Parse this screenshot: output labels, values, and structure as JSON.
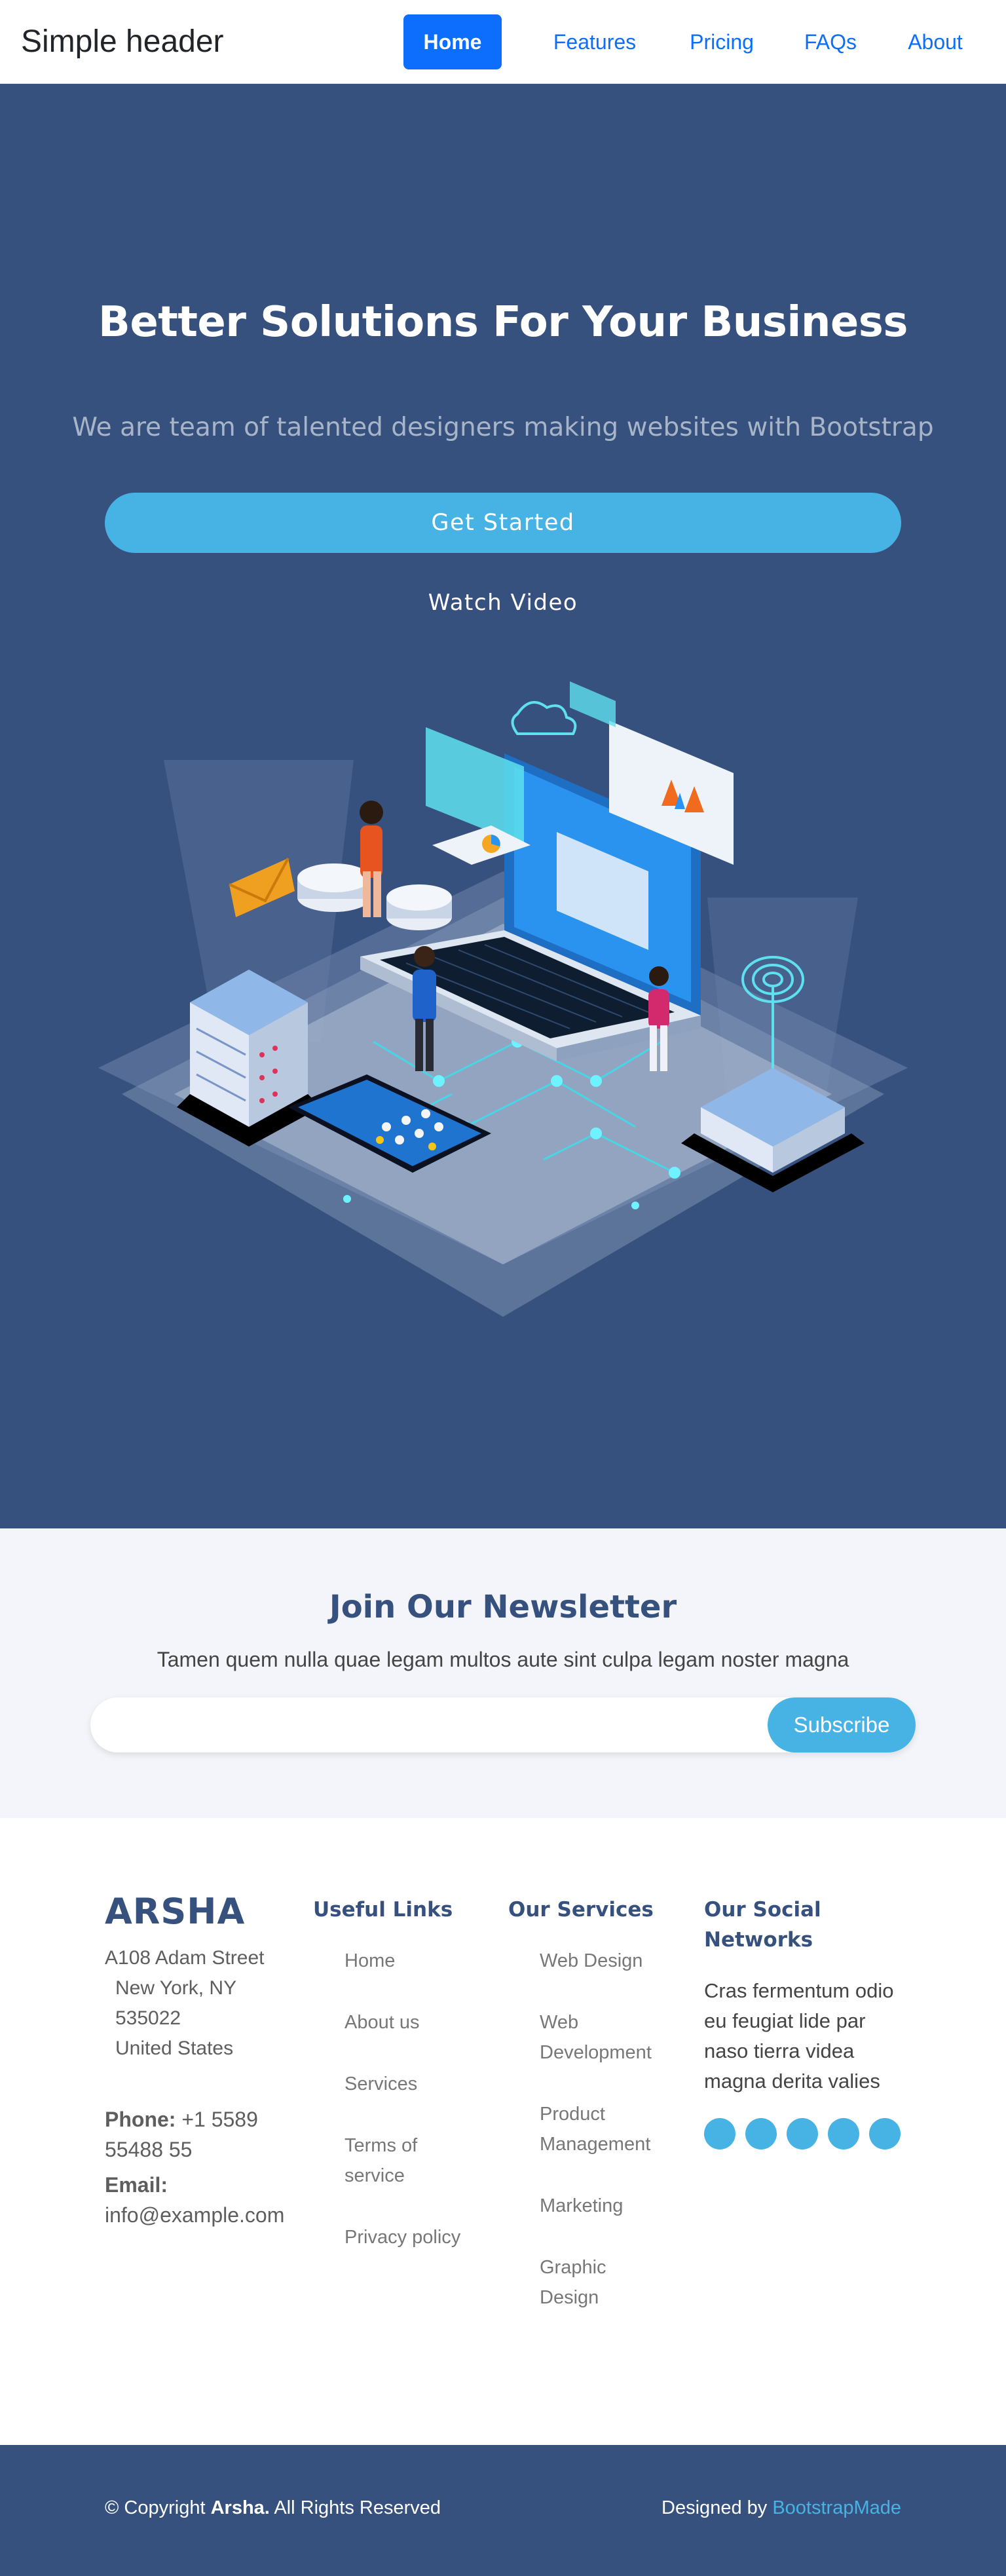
{
  "header": {
    "brand": "Simple header",
    "nav": [
      "Home",
      "Features",
      "Pricing",
      "FAQs",
      "About"
    ],
    "active": "Home"
  },
  "hero": {
    "title": "Better Solutions For Your Business",
    "subtitle": "We are team of talented designers making websites with Bootstrap",
    "cta": "Get Started",
    "video": "Watch Video",
    "illustration": "isometric-laptop-server-illustration"
  },
  "newsletter": {
    "title": "Join Our Newsletter",
    "text": "Tamen quem nulla quae legam multos aute sint culpa legam noster magna",
    "input_placeholder": "",
    "button": "Subscribe"
  },
  "footer": {
    "logo": "ARSHA",
    "address": {
      "line1": "A108 Adam Street",
      "line2": "New York, NY 535022",
      "line3": "United States"
    },
    "phone_label": "Phone:",
    "phone": "+1 5589 55488 55",
    "email_label": "Email:",
    "email": "info@example.com",
    "useful_links": {
      "title": "Useful Links",
      "items": [
        "Home",
        "About us",
        "Services",
        "Terms of service",
        "Privacy policy"
      ]
    },
    "services": {
      "title": "Our Services",
      "items": [
        "Web Design",
        "Web Development",
        "Product Management",
        "Marketing",
        "Graphic Design"
      ]
    },
    "social": {
      "title": "Our Social Networks",
      "text": "Cras fermentum odio eu feugiat lide par naso tierra videa magna derita valies",
      "icons": [
        "twitter-icon",
        "facebook-icon",
        "instagram-icon",
        "skype-icon",
        "linkedin-icon"
      ]
    },
    "copyright_prefix": "© Copyright",
    "copyright_brand": "Arsha.",
    "copyright_suffix": "All Rights Reserved",
    "designed_by": "Designed by",
    "designed_link": "BootstrapMade"
  },
  "colors": {
    "hero_bg": "#37517e",
    "accent": "#47b2e4",
    "primary": "#0d6efd",
    "newsletter_bg": "#f3f5fa"
  }
}
